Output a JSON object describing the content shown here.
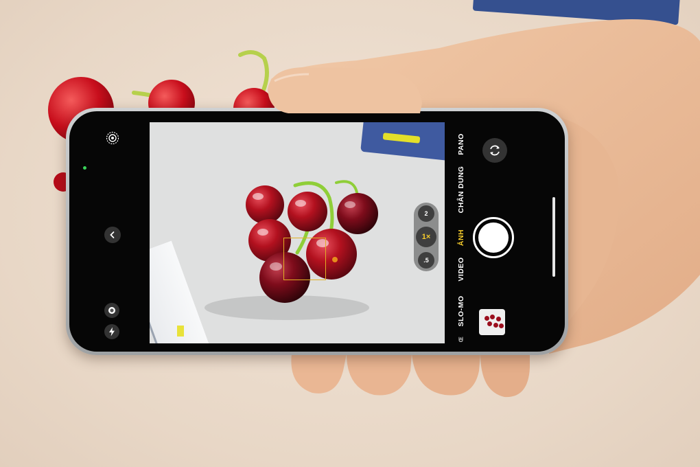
{
  "camera": {
    "zoom_levels": [
      "2",
      "1×",
      ".5"
    ],
    "active_zoom": "1×",
    "modes": [
      "PANO",
      "CHÂN DUNG",
      "ẢNH",
      "VIDEO",
      "SLO-MO",
      "Œ"
    ],
    "active_mode": "ẢNH"
  },
  "icons": {
    "live_photo": "live-photo-icon",
    "back": "chevron-left-icon",
    "night": "night-mode-icon",
    "flash": "flash-icon",
    "flip": "flip-camera-icon"
  },
  "colors": {
    "accent_yellow": "#f6cc2c",
    "focus_box": "#e0b024",
    "cherry": "#9b0f1e"
  }
}
